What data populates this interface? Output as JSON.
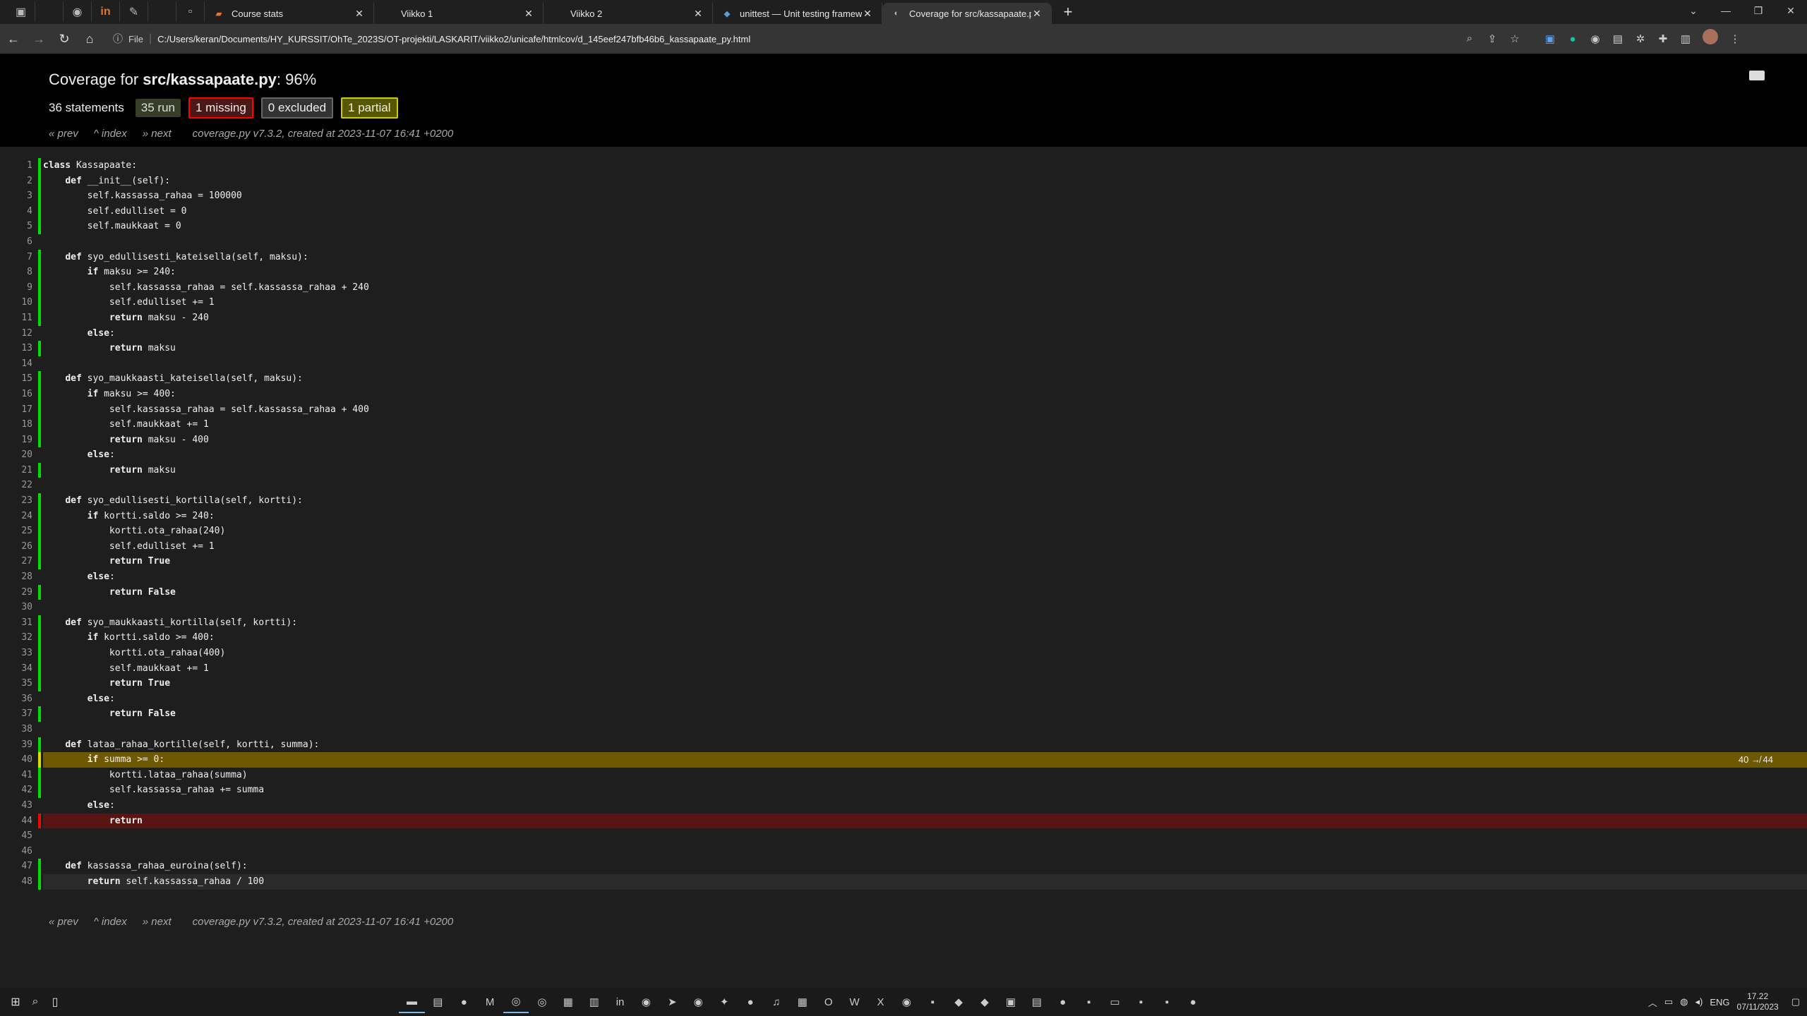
{
  "browser": {
    "pinned_tabs": [
      "app-icon",
      "blank",
      "github-icon",
      "linkedin-icon",
      "pen-icon",
      "blank",
      "blank"
    ],
    "tabs": [
      {
        "label": "Course stats",
        "icon": "mooc-icon",
        "active": false
      },
      {
        "label": "Viikko 1",
        "icon": "doc-icon",
        "active": false
      },
      {
        "label": "Viikko 2",
        "icon": "doc-icon",
        "active": false
      },
      {
        "label": "unittest — Unit testing framewo",
        "icon": "python-icon",
        "active": false
      },
      {
        "label": "Coverage for src/kassapaate.py:",
        "icon": "coverage-icon",
        "active": true
      }
    ],
    "omnibox": {
      "scheme_label": "File",
      "url": "C:/Users/keran/Documents/HY_KURSSIT/OhTe_2023S/OT-projekti/LASKARIT/viikko2/unicafe/htmlcov/d_145eef247bfb46b6_kassapaate_py.html"
    }
  },
  "report": {
    "title_prefix": "Coverage for ",
    "file": "src/kassapaate.py",
    "percent": ": 96%",
    "statements": "36 statements",
    "run": "35 run",
    "missing": "1 missing",
    "excluded": "0 excluded",
    "partial": "1 partial",
    "nav": {
      "prev": "« prev",
      "index": "^ index",
      "next": "» next"
    },
    "generated": "coverage.py v7.3.2, created at 2023-11-07 16:41 +0200"
  },
  "code_lines": [
    {
      "n": "1",
      "t": "class Kassapaate:",
      "s": "run"
    },
    {
      "n": "2",
      "t": "    def __init__(self):",
      "s": "run"
    },
    {
      "n": "3",
      "t": "        self.kassassa_rahaa = 100000",
      "s": "run"
    },
    {
      "n": "4",
      "t": "        self.edulliset = 0",
      "s": "run"
    },
    {
      "n": "5",
      "t": "        self.maukkaat = 0",
      "s": "run"
    },
    {
      "n": "6",
      "t": "",
      "s": ""
    },
    {
      "n": "7",
      "t": "    def syo_edullisesti_kateisella(self, maksu):",
      "s": "run"
    },
    {
      "n": "8",
      "t": "        if maksu >= 240:",
      "s": "run"
    },
    {
      "n": "9",
      "t": "            self.kassassa_rahaa = self.kassassa_rahaa + 240",
      "s": "run"
    },
    {
      "n": "10",
      "t": "            self.edulliset += 1",
      "s": "run"
    },
    {
      "n": "11",
      "t": "            return maksu - 240",
      "s": "run"
    },
    {
      "n": "12",
      "t": "        else:",
      "s": ""
    },
    {
      "n": "13",
      "t": "            return maksu",
      "s": "run"
    },
    {
      "n": "14",
      "t": "",
      "s": ""
    },
    {
      "n": "15",
      "t": "    def syo_maukkaasti_kateisella(self, maksu):",
      "s": "run"
    },
    {
      "n": "16",
      "t": "        if maksu >= 400:",
      "s": "run"
    },
    {
      "n": "17",
      "t": "            self.kassassa_rahaa = self.kassassa_rahaa + 400",
      "s": "run"
    },
    {
      "n": "18",
      "t": "            self.maukkaat += 1",
      "s": "run"
    },
    {
      "n": "19",
      "t": "            return maksu - 400",
      "s": "run"
    },
    {
      "n": "20",
      "t": "        else:",
      "s": ""
    },
    {
      "n": "21",
      "t": "            return maksu",
      "s": "run"
    },
    {
      "n": "22",
      "t": "",
      "s": ""
    },
    {
      "n": "23",
      "t": "    def syo_edullisesti_kortilla(self, kortti):",
      "s": "run"
    },
    {
      "n": "24",
      "t": "        if kortti.saldo >= 240:",
      "s": "run"
    },
    {
      "n": "25",
      "t": "            kortti.ota_rahaa(240)",
      "s": "run"
    },
    {
      "n": "26",
      "t": "            self.edulliset += 1",
      "s": "run"
    },
    {
      "n": "27",
      "t": "            return True",
      "s": "run"
    },
    {
      "n": "28",
      "t": "        else:",
      "s": ""
    },
    {
      "n": "29",
      "t": "            return False",
      "s": "run"
    },
    {
      "n": "30",
      "t": "",
      "s": ""
    },
    {
      "n": "31",
      "t": "    def syo_maukkaasti_kortilla(self, kortti):",
      "s": "run"
    },
    {
      "n": "32",
      "t": "        if kortti.saldo >= 400:",
      "s": "run"
    },
    {
      "n": "33",
      "t": "            kortti.ota_rahaa(400)",
      "s": "run"
    },
    {
      "n": "34",
      "t": "            self.maukkaat += 1",
      "s": "run"
    },
    {
      "n": "35",
      "t": "            return True",
      "s": "run"
    },
    {
      "n": "36",
      "t": "        else:",
      "s": ""
    },
    {
      "n": "37",
      "t": "            return False",
      "s": "run"
    },
    {
      "n": "38",
      "t": "",
      "s": ""
    },
    {
      "n": "39",
      "t": "    def lataa_rahaa_kortille(self, kortti, summa):",
      "s": "run"
    },
    {
      "n": "40",
      "t": "        if summa >= 0:",
      "s": "par",
      "annot": "40 ↛ 44"
    },
    {
      "n": "41",
      "t": "            kortti.lataa_rahaa(summa)",
      "s": "run"
    },
    {
      "n": "42",
      "t": "            self.kassassa_rahaa += summa",
      "s": "run"
    },
    {
      "n": "43",
      "t": "        else:",
      "s": ""
    },
    {
      "n": "44",
      "t": "            return",
      "s": "mis"
    },
    {
      "n": "45",
      "t": "",
      "s": ""
    },
    {
      "n": "46",
      "t": "",
      "s": ""
    },
    {
      "n": "47",
      "t": "    def kassassa_rahaa_euroina(self):",
      "s": "run"
    },
    {
      "n": "48",
      "t": "        return self.kassassa_rahaa / 100",
      "s": "run"
    }
  ],
  "taskbar": {
    "apps": [
      "file-explorer-icon",
      "notes-icon",
      "apple-icon",
      "gmail-icon",
      "chrome-icon",
      "chrome-alt-icon",
      "store-icon",
      "trello-icon",
      "linkedin-icon",
      "whatsapp-icon",
      "telegram-icon",
      "messenger-icon",
      "twitter-icon",
      "reddit-icon",
      "music-icon",
      "calc-icon",
      "outlook-icon",
      "word-icon",
      "excel-icon",
      "github-icon",
      "app-icon",
      "vscode-icon",
      "visual-studio-icon",
      "pycharm-icon",
      "notepad-icon",
      "app-red-icon",
      "app-icon",
      "terminal-icon",
      "app-icon",
      "app-icon",
      "app-blue-icon"
    ],
    "lang": "ENG",
    "time": "17.22",
    "date": "07/11/2023"
  },
  "colors": {
    "run": "#00dd00",
    "missing": "#ff0000",
    "partial": "#dddd00",
    "partial_bg": "#6e5800",
    "missing_bg": "#5a1414"
  }
}
